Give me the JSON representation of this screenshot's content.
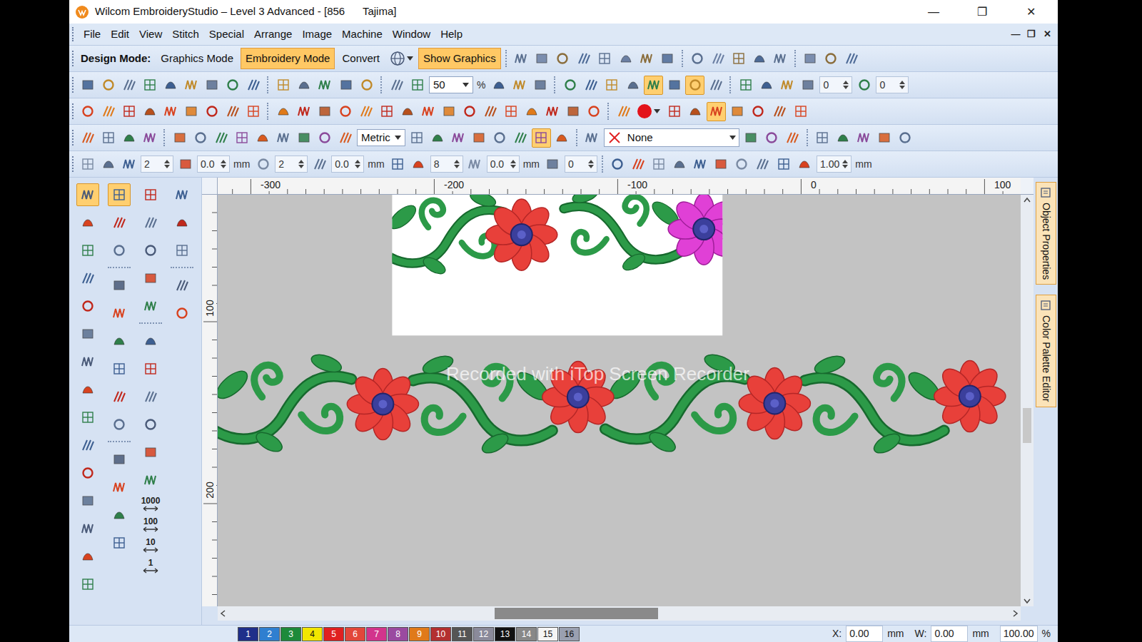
{
  "window": {
    "title": "Wilcom EmbroideryStudio – Level 3 Advanced - [856      Tajima]",
    "controls": [
      "—",
      "❐",
      "✕"
    ]
  },
  "menu": {
    "items": [
      "File",
      "Edit",
      "View",
      "Stitch",
      "Special",
      "Arrange",
      "Image",
      "Machine",
      "Window",
      "Help"
    ],
    "controls": [
      "—",
      "❐",
      "✕"
    ]
  },
  "toolbars": [
    [
      {
        "kind": "label",
        "value": "Design Mode:"
      },
      {
        "kind": "button",
        "value": "Graphics Mode",
        "selected": false
      },
      {
        "kind": "button",
        "value": "Embroidery Mode",
        "selected": true
      },
      {
        "kind": "button",
        "value": "Convert",
        "selected": false
      },
      {
        "kind": "globe"
      },
      {
        "kind": "button",
        "value": "Show Graphics",
        "selected": true
      },
      {
        "kind": "sep"
      },
      {
        "kind": "icons",
        "on": [
          false,
          false,
          false
        ]
      },
      {
        "kind": "icons",
        "on": [
          false,
          false
        ]
      },
      {
        "kind": "icons",
        "on": [
          false,
          false,
          false
        ]
      },
      {
        "kind": "sep"
      },
      {
        "kind": "icons",
        "on": [
          false,
          false,
          false,
          false,
          false
        ]
      },
      {
        "kind": "sep"
      },
      {
        "kind": "icons",
        "on": [
          false,
          false,
          false
        ]
      }
    ],
    [
      {
        "kind": "icons",
        "on": [
          false,
          false,
          false,
          false,
          false,
          false,
          false,
          false,
          false
        ]
      },
      {
        "kind": "sep"
      },
      {
        "kind": "icons",
        "on": [
          false,
          false,
          false
        ]
      },
      {
        "kind": "icons",
        "on": [
          false,
          false
        ]
      },
      {
        "kind": "sep"
      },
      {
        "kind": "icons",
        "on": [
          false,
          false
        ]
      },
      {
        "kind": "dropdown",
        "value": "50"
      },
      {
        "kind": "text",
        "value": "%"
      },
      {
        "kind": "icons",
        "on": [
          false,
          false,
          false
        ]
      },
      {
        "kind": "sep"
      },
      {
        "kind": "icons",
        "on": [
          false,
          false,
          false
        ]
      },
      {
        "kind": "icons",
        "on": [
          false,
          true,
          false,
          true,
          false
        ]
      },
      {
        "kind": "sep"
      },
      {
        "kind": "icons",
        "on": [
          false,
          false,
          false,
          false
        ]
      },
      {
        "kind": "spin",
        "value": "0"
      },
      {
        "kind": "icons",
        "on": [
          false
        ]
      },
      {
        "kind": "spin",
        "value": "0"
      }
    ],
    [
      {
        "kind": "icons",
        "on": [
          false,
          false,
          false,
          false,
          false,
          false,
          false,
          false,
          false
        ]
      },
      {
        "kind": "sep"
      },
      {
        "kind": "icons",
        "on": [
          false,
          false,
          false,
          false,
          false,
          false,
          false,
          false,
          false,
          false,
          false,
          false,
          false,
          false,
          false,
          false
        ]
      },
      {
        "kind": "sep"
      },
      {
        "kind": "icons",
        "on": [
          false
        ]
      },
      {
        "kind": "colorpick",
        "color": "#e3131b"
      },
      {
        "kind": "icons",
        "on": [
          false,
          false
        ]
      },
      {
        "kind": "icons",
        "on": [
          true,
          false,
          false
        ]
      },
      {
        "kind": "icons",
        "on": [
          false
        ]
      },
      {
        "kind": "icons",
        "on": [
          false
        ]
      }
    ],
    [
      {
        "kind": "icons",
        "on": [
          false,
          false,
          false,
          false
        ]
      },
      {
        "kind": "sep"
      },
      {
        "kind": "icons",
        "on": [
          false,
          false,
          false,
          false,
          false,
          false,
          false,
          false,
          false
        ]
      },
      {
        "kind": "dropdown",
        "value": "Metric"
      },
      {
        "kind": "icons",
        "on": [
          false,
          false,
          false,
          false,
          false,
          false,
          true,
          false
        ]
      },
      {
        "kind": "sep"
      },
      {
        "kind": "icons",
        "on": [
          false
        ]
      },
      {
        "kind": "thread",
        "value": "None"
      },
      {
        "kind": "icons",
        "on": [
          false,
          false,
          false
        ]
      },
      {
        "kind": "sep"
      },
      {
        "kind": "icons",
        "on": [
          false,
          false,
          false,
          false,
          false
        ]
      }
    ],
    [
      {
        "kind": "icons",
        "on": [
          false,
          false,
          false
        ]
      },
      {
        "kind": "spin",
        "value": "2"
      },
      {
        "kind": "icons",
        "on": [
          false
        ]
      },
      {
        "kind": "spin",
        "value": "0.0"
      },
      {
        "kind": "text",
        "value": "mm"
      },
      {
        "kind": "icons",
        "on": [
          false
        ]
      },
      {
        "kind": "spin",
        "value": "2"
      },
      {
        "kind": "icons",
        "on": [
          false
        ]
      },
      {
        "kind": "spin",
        "value": "0.0"
      },
      {
        "kind": "text",
        "value": "mm"
      },
      {
        "kind": "icons",
        "on": [
          false,
          false
        ]
      },
      {
        "kind": "spin",
        "value": "8"
      },
      {
        "kind": "icons",
        "on": [
          false
        ]
      },
      {
        "kind": "spin",
        "value": "0.0"
      },
      {
        "kind": "text",
        "value": "mm"
      },
      {
        "kind": "icons",
        "on": [
          false
        ]
      },
      {
        "kind": "spin",
        "value": "0"
      },
      {
        "kind": "sep"
      },
      {
        "kind": "icons",
        "on": [
          false,
          false,
          false,
          false,
          false,
          false,
          false,
          false
        ]
      },
      {
        "kind": "icons",
        "on": [
          false,
          false
        ]
      },
      {
        "kind": "spin",
        "value": "1.00"
      },
      {
        "kind": "text",
        "value": "mm"
      }
    ]
  ],
  "toolbox": [
    [
      {
        "kind": "icons",
        "on": [
          true,
          false,
          false,
          false,
          false,
          false,
          false,
          false,
          false,
          false,
          false,
          false,
          false,
          false,
          false
        ]
      }
    ],
    [
      {
        "kind": "icons",
        "on": [
          true,
          false,
          false
        ]
      },
      {
        "kind": "sep"
      },
      {
        "kind": "icons",
        "on": [
          false,
          false,
          false,
          false,
          false,
          false
        ]
      },
      {
        "kind": "sep"
      },
      {
        "kind": "icons",
        "on": [
          false,
          false,
          false,
          false
        ]
      }
    ],
    [
      {
        "kind": "icons",
        "on": [
          false,
          false,
          false,
          false,
          false
        ]
      },
      {
        "kind": "sep"
      },
      {
        "kind": "icons",
        "on": [
          false,
          false,
          false,
          false,
          false,
          false
        ]
      },
      {
        "kind": "step",
        "label": "1000"
      },
      {
        "kind": "step",
        "label": "100"
      },
      {
        "kind": "step",
        "label": "10"
      },
      {
        "kind": "step",
        "label": "1"
      }
    ],
    [
      {
        "kind": "icons",
        "on": [
          false,
          false,
          false
        ]
      },
      {
        "kind": "sep"
      },
      {
        "kind": "icons",
        "on": [
          false,
          false
        ]
      }
    ]
  ],
  "rulers": {
    "top": [
      "-300",
      "-200",
      "-100",
      "0",
      "100"
    ],
    "left": [
      "100",
      "200"
    ]
  },
  "canvas": {
    "watermark": "Recorded with iTop Screen Recorder"
  },
  "scroll": {
    "horizontal": {
      "start": 0.34,
      "level": 0.21
    },
    "vertical": {
      "start": 0.52,
      "level": 0.09
    }
  },
  "side_tabs": [
    "Object Properties",
    "Color Palette Editor"
  ],
  "status_bar": {
    "colors": [
      {
        "label": "1",
        "color": "#1f2f8a"
      },
      {
        "label": "2",
        "color": "#2f7fd0"
      },
      {
        "label": "3",
        "color": "#1d8a3a"
      },
      {
        "label": "4",
        "color": "#f2e600"
      },
      {
        "label": "5",
        "color": "#e02020"
      },
      {
        "label": "6",
        "color": "#e2473a"
      },
      {
        "label": "7",
        "color": "#d2348c"
      },
      {
        "label": "8",
        "color": "#9a4aa0"
      },
      {
        "label": "9",
        "color": "#e07a1a"
      },
      {
        "label": "10",
        "color": "#b33030"
      },
      {
        "label": "11",
        "color": "#555555"
      },
      {
        "label": "12",
        "color": "#8a8a9a"
      },
      {
        "label": "13",
        "color": "#111111"
      },
      {
        "label": "14",
        "color": "#888888"
      },
      {
        "label": "15",
        "color": "#f4f4f4"
      },
      {
        "label": "16",
        "color": "#9aa0b0"
      }
    ],
    "coords": [
      {
        "label": "X:",
        "value": "0.00",
        "unit": "mm"
      },
      {
        "label": "W:",
        "value": "0.00",
        "unit": "mm"
      }
    ],
    "zoom": {
      "value": "100.00",
      "unit": "%"
    }
  }
}
